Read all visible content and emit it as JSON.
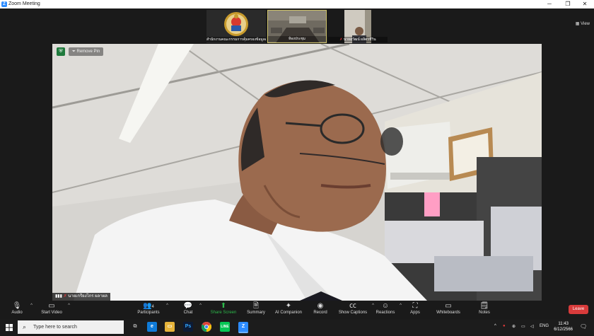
{
  "window": {
    "title": "Zoom Meeting",
    "minimize": "─",
    "maximize": "❐",
    "close": "✕"
  },
  "gallery": {
    "view_label": "View",
    "tiles": [
      {
        "name": "สำนักงานคณะกรรมการคุ้มครองข้อมูลส่วนบุคคล..."
      },
      {
        "name": "ห้องประชุม"
      },
      {
        "name": "นายสุวัฒน์ ผลิตรชีวิน"
      }
    ]
  },
  "main_video": {
    "remove_pin_label": "Remove Pin",
    "participant_name": "นายเกรียงไกร ผลาผล"
  },
  "toolbar": {
    "audio": "Audio",
    "start_video": "Start Video",
    "participants": "Participants",
    "participants_count": "4",
    "chat": "Chat",
    "share_screen": "Share Screen",
    "summary": "Summary",
    "ai_companion": "AI Companion",
    "record": "Record",
    "show_captions": "Show Captions",
    "reactions": "Reactions",
    "apps": "Apps",
    "whiteboards": "Whiteboards",
    "notes": "Notes",
    "leave": "Leave"
  },
  "taskbar": {
    "search_placeholder": "Type here to search",
    "language": "ENG",
    "time": "11:43",
    "date": "6/12/2566"
  },
  "colors": {
    "share_green": "#2db84b",
    "leave_red": "#d83b3b",
    "zoom_blue": "#2d8cff"
  }
}
